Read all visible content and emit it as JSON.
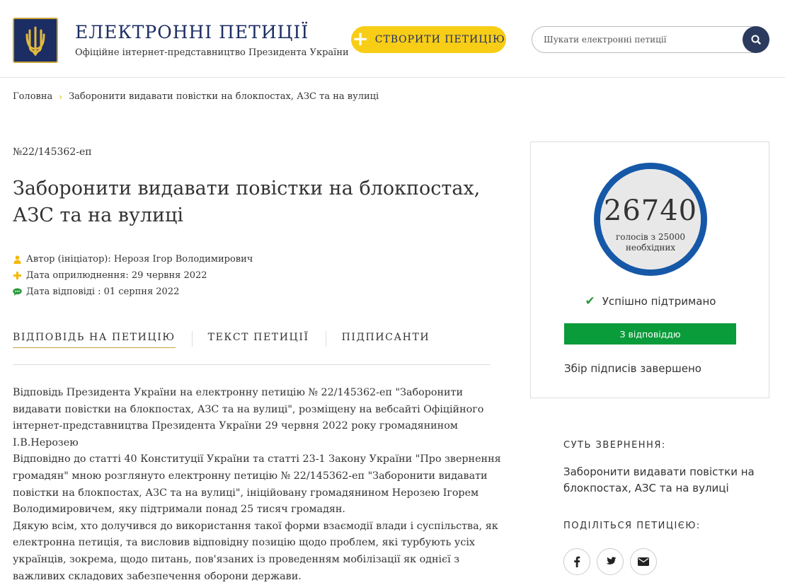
{
  "header": {
    "title": "ЕЛЕКТРОННІ ПЕТИЦІЇ",
    "subtitle": "Офіційне інтернет-представництво Президента України",
    "create_button": "СТВОРИТИ ПЕТИЦІЮ",
    "search_placeholder": "Шукати електронні петиції"
  },
  "breadcrumb": {
    "home": "Головна",
    "current": "Заборонити видавати повістки на блокпостах, АЗС та на вулиці"
  },
  "petition": {
    "number": "№22/145362-еп",
    "title": "Заборонити видавати повістки на блокпостах, АЗС та на вулиці",
    "author": "Автор (ініціатор): Нерозя Ігор Володимирович",
    "published": "Дата оприлюднення: 29 червня 2022",
    "answer_date": "Дата відповіді : 01 серпня 2022"
  },
  "tabs": [
    {
      "label": "ВІДПОВІДЬ НА ПЕТИЦІЮ"
    },
    {
      "label": "ТЕКСТ ПЕТИЦІЇ"
    },
    {
      "label": "ПІДПИСАНТИ"
    }
  ],
  "answer": {
    "p1": "Відповідь Президента України на електронну петицію № 22/145362-еп \"Заборонити видавати повістки на блокпостах, АЗС та на вулиці\", розміщену на вебсайті Офіційного інтернет-представництва Президента України 29 червня 2022 року громадянином І.В.Нерозею",
    "p2": "Відповідно до статті 40 Конституції України та статті 23-1 Закону України \"Про звернення громадян\" мною розглянуто електронну петицію № 22/145362-еп \"Заборонити видавати повістки на блокпостах, АЗС та на вулиці\", ініційовану громадянином Нерозею Ігорем Володимировичем, яку підтримали понад 25 тисяч громадян.",
    "p3": "Дякую всім, хто долучився до використання такої форми взаємодії влади і суспільства, як електронна петиція, та висловив відповідну позицію щодо проблем, які турбують усіх українців, зокрема, щодо питань, пов'язаних із проведенням мобілізації як однієї з важливих складових забезпечення оборони держави."
  },
  "sidebar": {
    "votes": "26740",
    "votes_sub": "голосів з 25000 необхідних",
    "status": "Успішно підтримано",
    "answered_button": "З відповіддю",
    "collection": "Збір підписів завершено",
    "essence_heading": "СУТЬ ЗВЕРНЕННЯ:",
    "essence_text": "Заборонити видавати повістки на блокпостах, АЗС та на вулиці",
    "share_heading": "ПОДІЛІТЬСЯ ПЕТИЦІЄЮ:"
  },
  "colors": {
    "brand": "#1c2d63",
    "accent": "#f8cd16",
    "counter_ring": "#1658a8",
    "answered": "#0a9b3a"
  },
  "icons": [
    "trident-logo-icon",
    "plus-icon",
    "search-icon",
    "user-icon",
    "plus-small-icon",
    "comment-icon",
    "check-icon",
    "facebook-icon",
    "twitter-icon",
    "email-icon"
  ]
}
